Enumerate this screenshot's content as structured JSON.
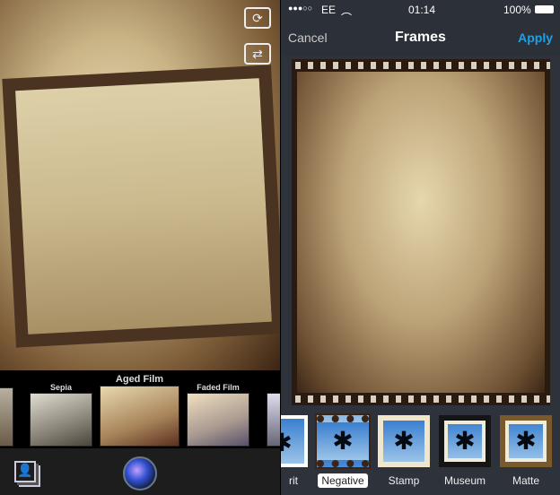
{
  "left": {
    "filters": [
      {
        "label": "Sepia"
      },
      {
        "label": "Aged Film",
        "selected": true
      },
      {
        "label": "Faded Film"
      }
    ],
    "icons": [
      "camera-rotate-icon",
      "camera-flip-icon",
      "photo-library-icon",
      "effects-lens-icon"
    ]
  },
  "right": {
    "status": {
      "signal": "●●●○○",
      "carrier": "EE",
      "time": "01:14",
      "battery": "100%"
    },
    "nav": {
      "cancel": "Cancel",
      "title": "Frames",
      "apply": "Apply"
    },
    "frames": [
      {
        "label": "rit"
      },
      {
        "label": "Negative",
        "selected": true
      },
      {
        "label": "Stamp"
      },
      {
        "label": "Museum"
      },
      {
        "label": "Matte"
      }
    ],
    "accent": "#1aa3e8"
  }
}
